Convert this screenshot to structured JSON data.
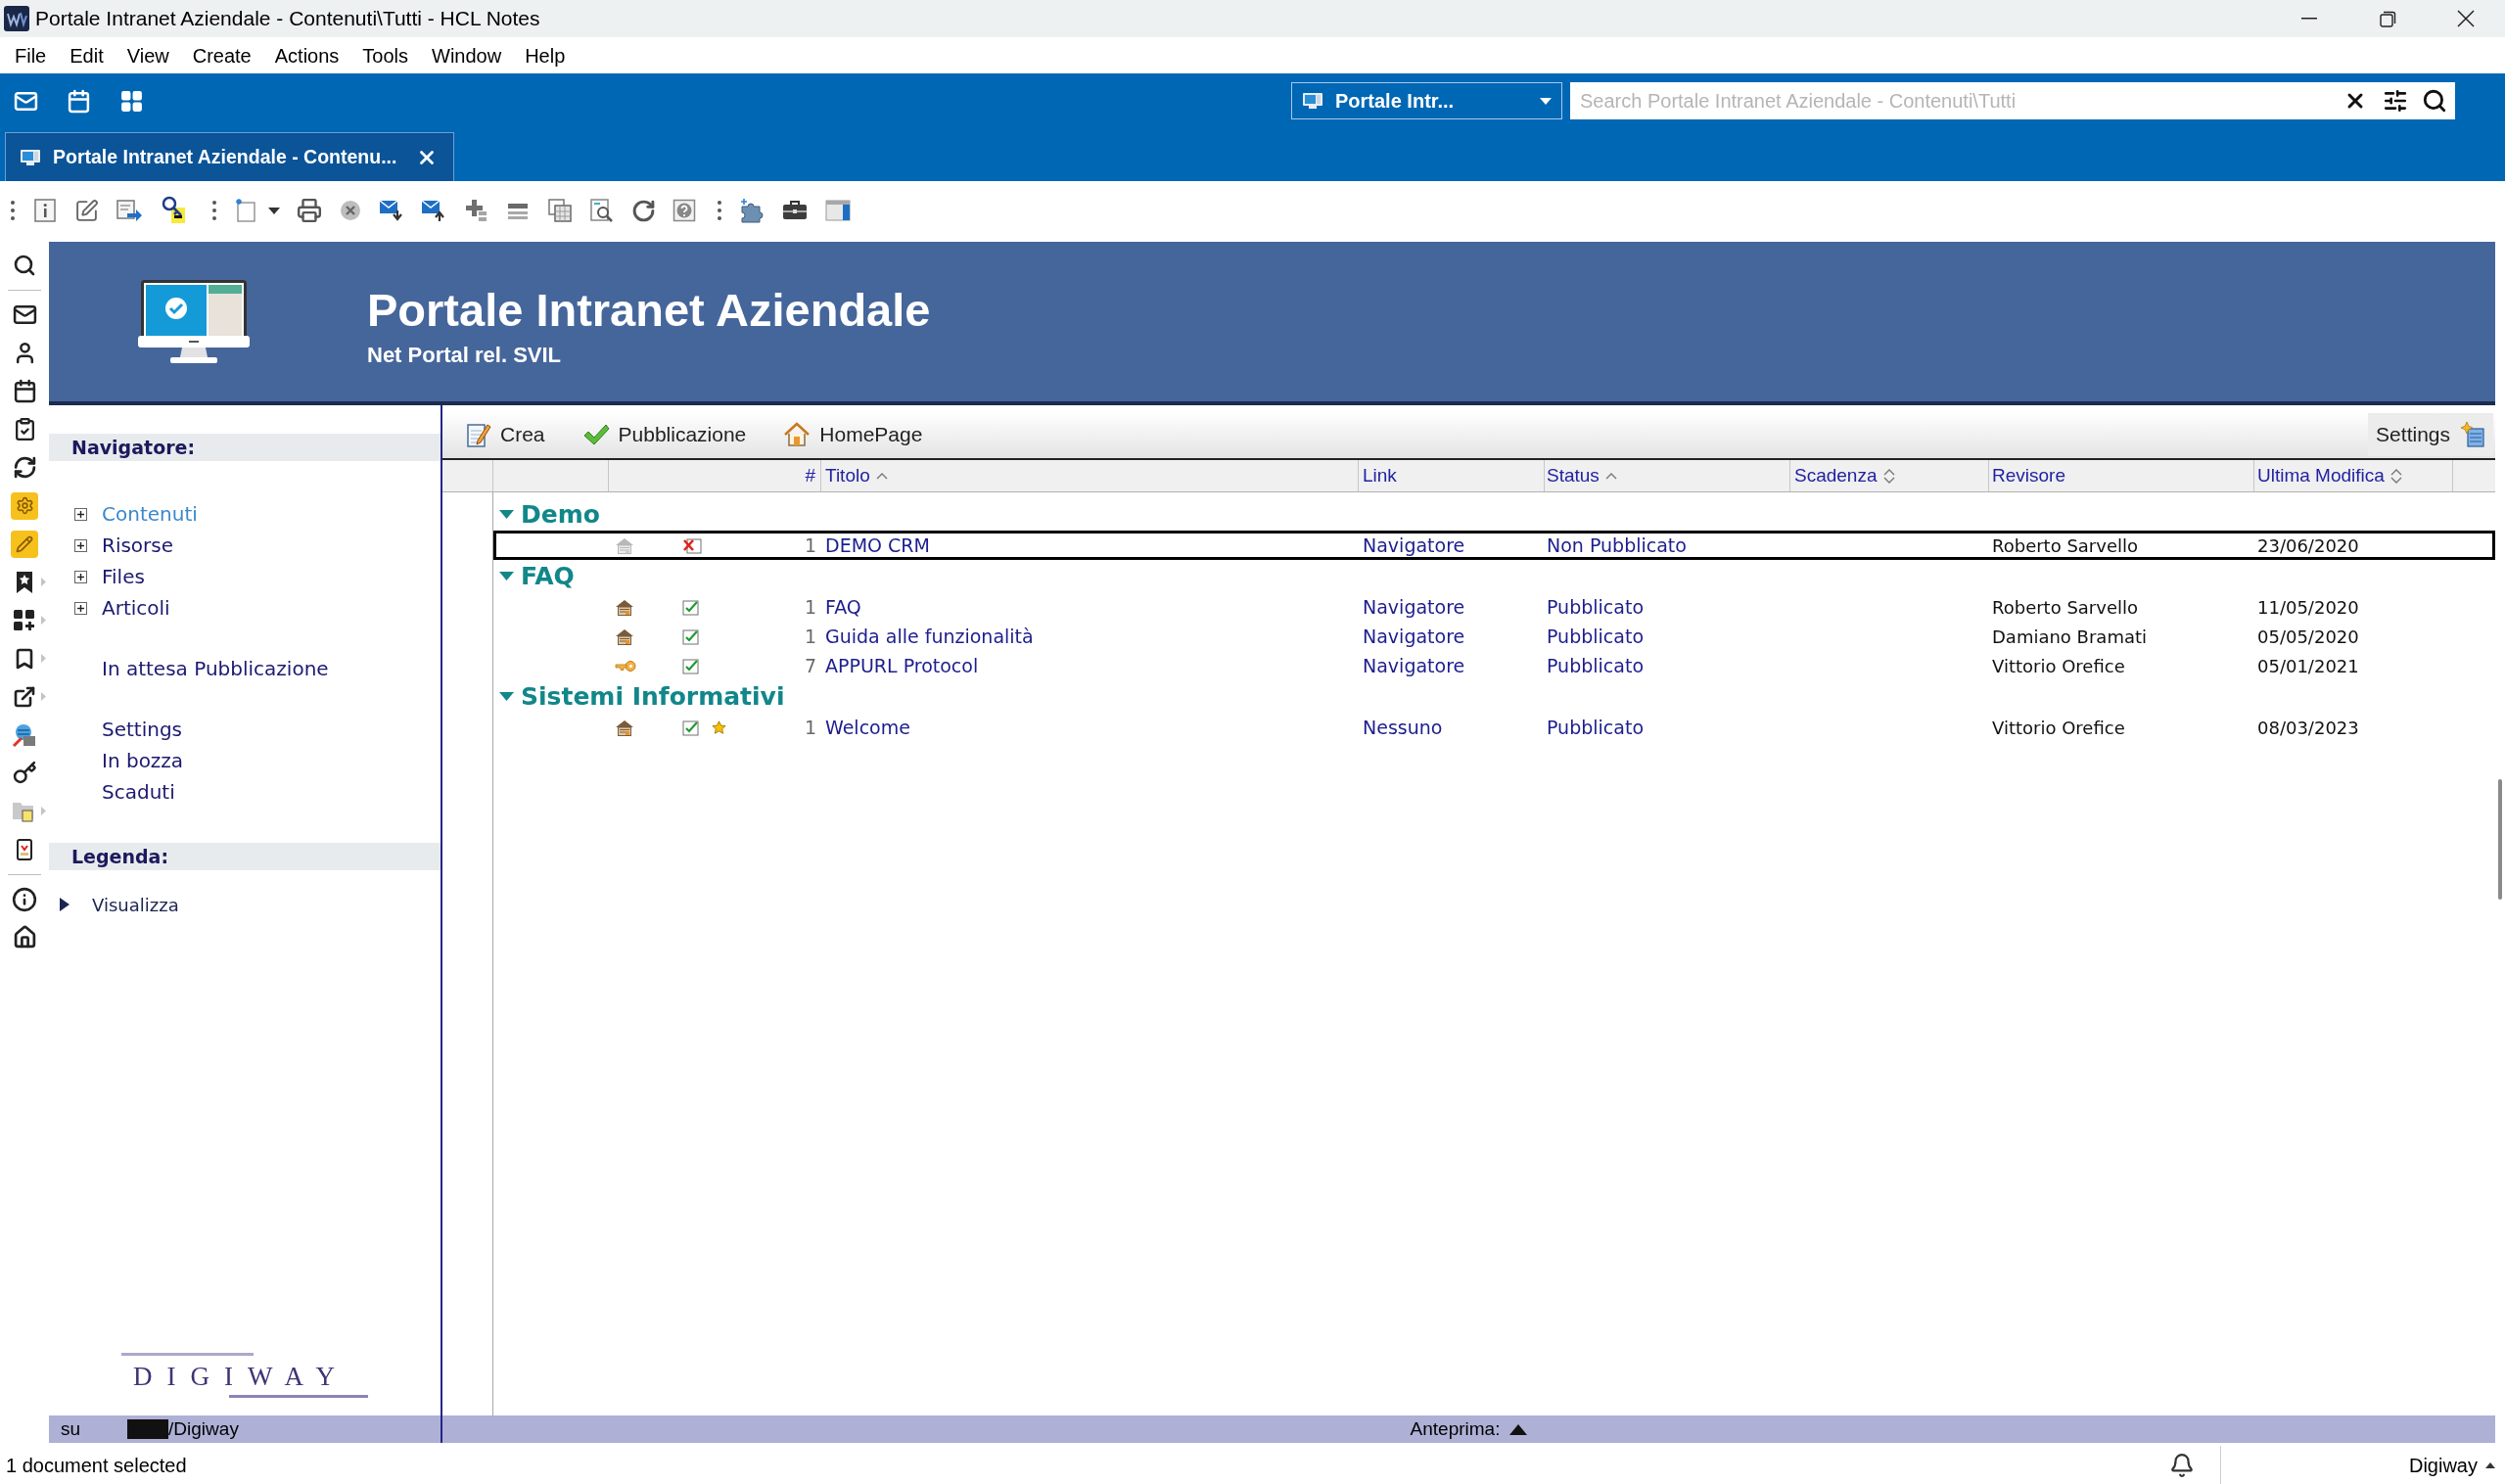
{
  "window": {
    "title": "Portale Intranet Aziendale - Contenuti\\Tutti - HCL Notes"
  },
  "menu": [
    "File",
    "Edit",
    "View",
    "Create",
    "Actions",
    "Tools",
    "Window",
    "Help"
  ],
  "switcher": {
    "label": "Portale Intr..."
  },
  "search": {
    "placeholder": "Search Portale Intranet Aziendale - Contenuti\\Tutti"
  },
  "tabs": [
    {
      "label": "Portale Intranet Aziendale - Contenu...",
      "selected": true
    }
  ],
  "banner": {
    "title": "Portale Intranet Aziendale",
    "subtitle": "Net Portal rel. SVIL"
  },
  "navigator": {
    "title": "Navigatore:",
    "groups": [
      {
        "items": [
          {
            "label": "Contenuti",
            "selected": true,
            "expanded": false
          },
          {
            "label": "Risorse",
            "selected": false,
            "expanded": false
          },
          {
            "label": "Files",
            "selected": false,
            "expanded": false
          },
          {
            "label": "Articoli",
            "selected": false,
            "expanded": false
          }
        ]
      },
      {
        "items": [
          {
            "label": "In attesa Pubblicazione",
            "selected": false
          }
        ]
      },
      {
        "items": [
          {
            "label": "Settings",
            "selected": false
          },
          {
            "label": "In bozza",
            "selected": false
          },
          {
            "label": "Scaduti",
            "selected": false
          }
        ]
      }
    ]
  },
  "legend": {
    "title": "Legenda:",
    "items": [
      {
        "label": "Visualizza",
        "expanded": false
      }
    ]
  },
  "logo": {
    "text": "DIGIWAY"
  },
  "view_actions": [
    {
      "kind": "create",
      "label": "Crea"
    },
    {
      "kind": "publish",
      "label": "Pubblicazione"
    },
    {
      "kind": "home",
      "label": "HomePage"
    }
  ],
  "view_settings": {
    "label": "Settings"
  },
  "table": {
    "columns": [
      {
        "label": "#",
        "sorted": false,
        "sortable": false
      },
      {
        "label": "Titolo",
        "sorted": true,
        "sortable": false
      },
      {
        "label": "Link",
        "sorted": false,
        "sortable": false
      },
      {
        "label": "Status",
        "sorted": true,
        "sortable": false
      },
      {
        "label": "Scadenza",
        "sorted": false,
        "sortable": true
      },
      {
        "label": "Revisore",
        "sorted": false,
        "sortable": false
      },
      {
        "label": "Ultima Modifica",
        "sorted": false,
        "sortable": true
      }
    ],
    "groups": [
      {
        "label": "Demo",
        "expanded": true,
        "rows": [
          {
            "kind": "document",
            "published": false,
            "starred": false,
            "selected": true,
            "number": "1",
            "title": "DEMO CRM",
            "link": "Navigatore",
            "status": "Non Pubblicato",
            "reviewer": "Roberto Sarvello",
            "modified": "23/06/2020"
          }
        ]
      },
      {
        "label": "FAQ",
        "expanded": true,
        "rows": [
          {
            "kind": "document",
            "published": true,
            "starred": false,
            "selected": false,
            "number": "1",
            "title": "FAQ",
            "link": "Navigatore",
            "status": "Pubblicato",
            "reviewer": "Roberto Sarvello",
            "modified": "11/05/2020"
          },
          {
            "kind": "document",
            "published": true,
            "starred": false,
            "selected": false,
            "number": "1",
            "title": "Guida alle funzionalità",
            "link": "Navigatore",
            "status": "Pubblicato",
            "reviewer": "Damiano Bramati",
            "modified": "05/05/2020"
          },
          {
            "kind": "link",
            "published": true,
            "starred": false,
            "selected": false,
            "number": "7",
            "title": "APPURL Protocol",
            "link": "Navigatore",
            "status": "Pubblicato",
            "reviewer": "Vittorio Orefice",
            "modified": "05/01/2021"
          }
        ]
      },
      {
        "label": "Sistemi Informativi",
        "expanded": true,
        "rows": [
          {
            "kind": "document",
            "published": true,
            "starred": true,
            "selected": false,
            "number": "1",
            "title": "Welcome",
            "link": "Nessuno",
            "status": "Pubblicato",
            "reviewer": "Vittorio Orefice",
            "modified": "08/03/2023"
          }
        ]
      }
    ]
  },
  "location_bar": {
    "prefix": "su",
    "path": "/Digiway"
  },
  "preview": {
    "label": "Anteprima:",
    "expanded": false
  },
  "status_bar": {
    "message": "1 document selected",
    "account": "Digiway"
  }
}
